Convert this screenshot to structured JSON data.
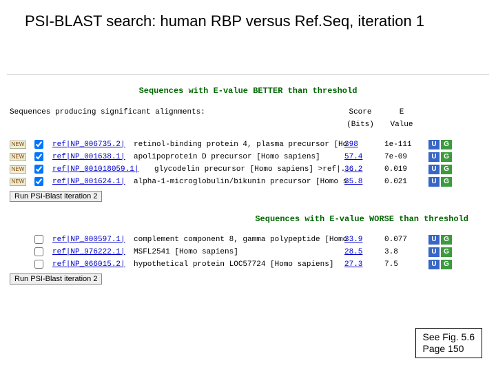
{
  "title": "PSI-BLAST search: human RBP versus Ref.Seq, iteration 1",
  "section_better": "Sequences with E-value BETTER than threshold",
  "section_worse": "Sequences with E-value WORSE than threshold",
  "labels": {
    "seq": "Sequences producing significant alignments:",
    "score1": "Score",
    "score2": "(Bits)",
    "eval1": "E",
    "eval2": "Value",
    "new": "NEW"
  },
  "better": [
    {
      "acc": "ref|NP_006735.2|",
      "desc": "retinol-binding protein 4, plasma precursor [Ho",
      "score": " 398",
      "evalue": "1e-111"
    },
    {
      "acc": "ref|NP_001638.1|",
      "desc": "apolipoprotein D precursor [Homo sapiens]",
      "score": "57.4",
      "evalue": "7e-09"
    },
    {
      "acc": "ref|NP_001018059.1|",
      "desc": "glycodelin precursor [Homo sapiens] >ref|...",
      "score": "36.2",
      "evalue": "0.019"
    },
    {
      "acc": "ref|NP_001624.1|",
      "desc": "alpha-1-microglobulin/bikunin precursor [Homo s",
      "score": "35.8",
      "evalue": "0.021"
    }
  ],
  "worse": [
    {
      "acc": "ref|NP_000597.1|",
      "desc": "complement component 8, gamma polypeptide [Homo",
      "score": "33.9",
      "evalue": "0.077"
    },
    {
      "acc": "ref|NP_976222.1|",
      "desc": "MSFL2541 [Homo sapiens]",
      "score": "28.5",
      "evalue": "3.8"
    },
    {
      "acc": "ref|NP_066015.2|",
      "desc": "hypothetical protein LOC57724 [Homo sapiens]",
      "score": "27.3",
      "evalue": "7.5"
    }
  ],
  "run_btn": "Run PSI-Blast iteration 2",
  "footer": "See Fig. 5.6\nPage 150",
  "icon_u": "U",
  "icon_g": "G"
}
